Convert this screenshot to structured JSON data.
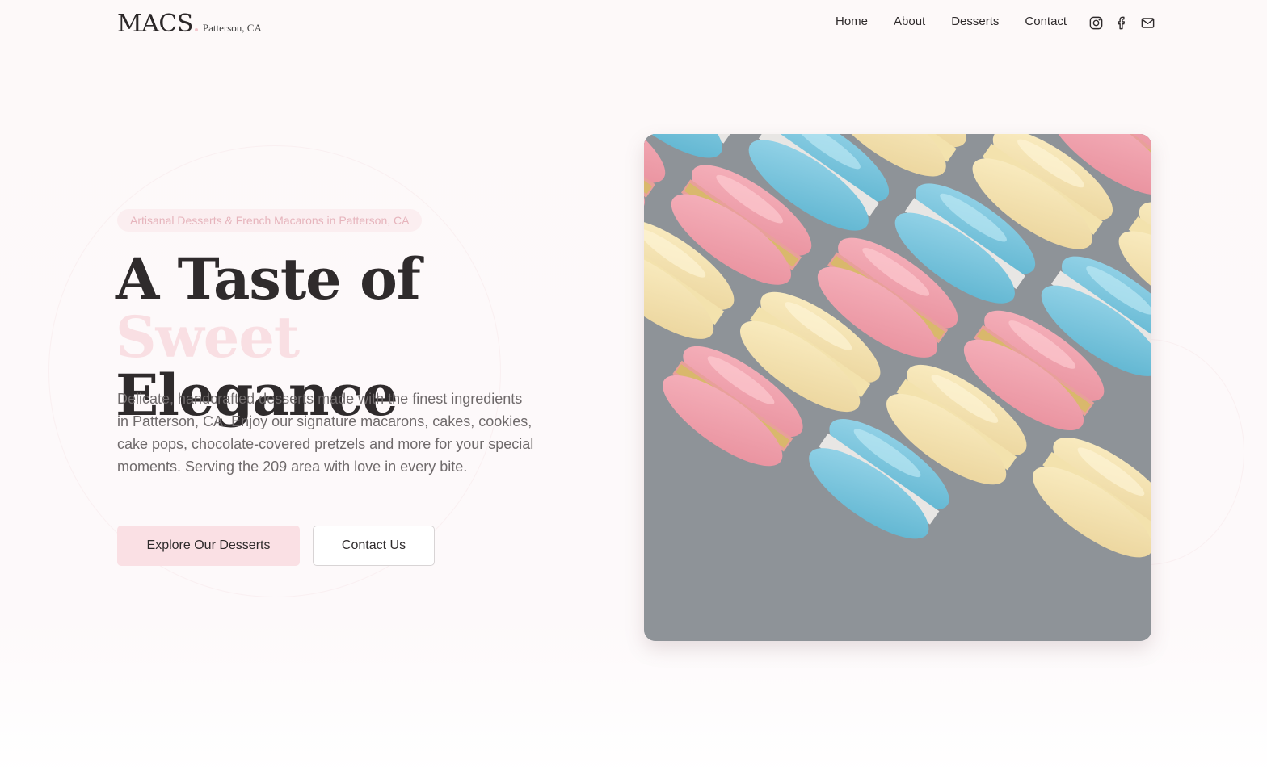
{
  "brand": {
    "name": "MACS",
    "location": "Patterson, CA"
  },
  "nav": {
    "items": [
      {
        "label": "Home"
      },
      {
        "label": "About"
      },
      {
        "label": "Desserts"
      },
      {
        "label": "Contact"
      }
    ]
  },
  "social": {
    "icons": [
      "instagram-icon",
      "facebook-icon",
      "mail-icon"
    ]
  },
  "hero": {
    "badge": "Artisanal Desserts & French Macarons in Patterson, CA",
    "title_line1": "A Taste of",
    "title_accent": "Sweet",
    "title_end": "Elegance",
    "description": "Delicate, handcrafted desserts made with the finest ingredients in Patterson, CA. Enjoy our signature macarons, cakes, cookies, cake pops, chocolate-covered pretzels and more for your special moments. Serving the 209 area with love in every bite.",
    "primary_button": "Explore Our Desserts",
    "secondary_button": "Contact Us"
  },
  "colors": {
    "accent_pink": "#fae0e4",
    "title_accent": "#f9dfe3",
    "text_dark": "#2e2a2b",
    "text_muted": "#6f6a6b"
  }
}
